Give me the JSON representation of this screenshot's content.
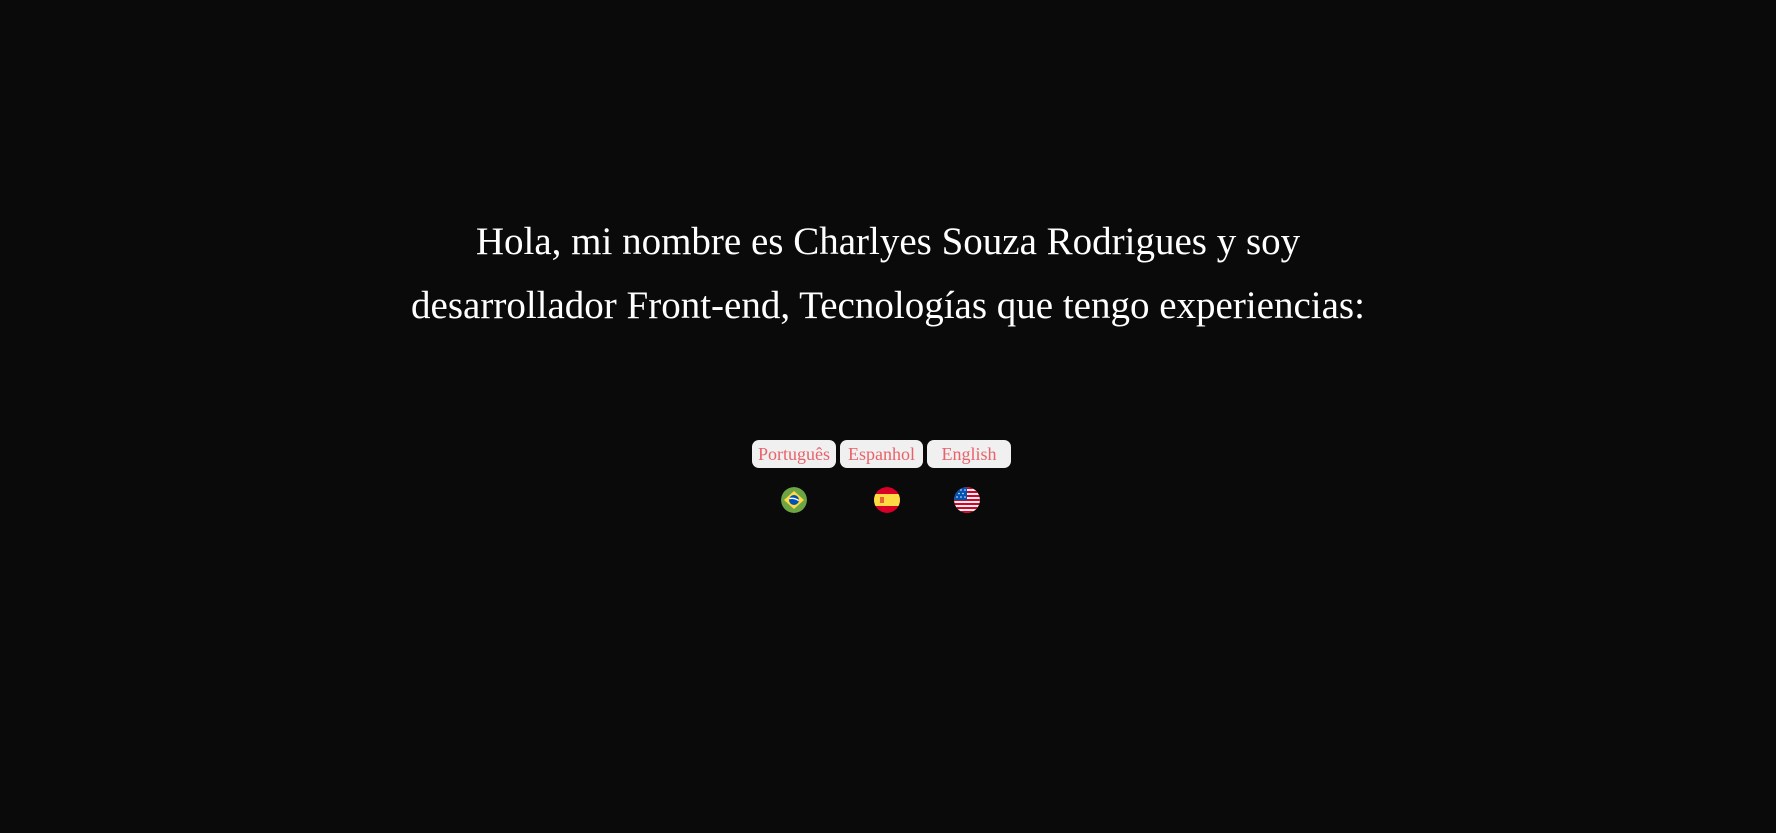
{
  "intro": {
    "line1": "Hola, mi nombre es Charlyes Souza Rodrigues y soy",
    "line2": "desarrollador Front-end, Tecnologías que tengo experiencias:"
  },
  "languages": {
    "buttons": [
      {
        "label": "Português"
      },
      {
        "label": "Espanhol"
      },
      {
        "label": "English"
      }
    ],
    "flags": [
      {
        "icon": "brazil-flag-icon"
      },
      {
        "icon": "spain-flag-icon"
      },
      {
        "icon": "usa-flag-icon"
      }
    ]
  },
  "colors": {
    "background": "#0a0a0a",
    "text": "#ffffff",
    "button_bg": "#f0f0f0",
    "button_text": "#e8626a"
  }
}
